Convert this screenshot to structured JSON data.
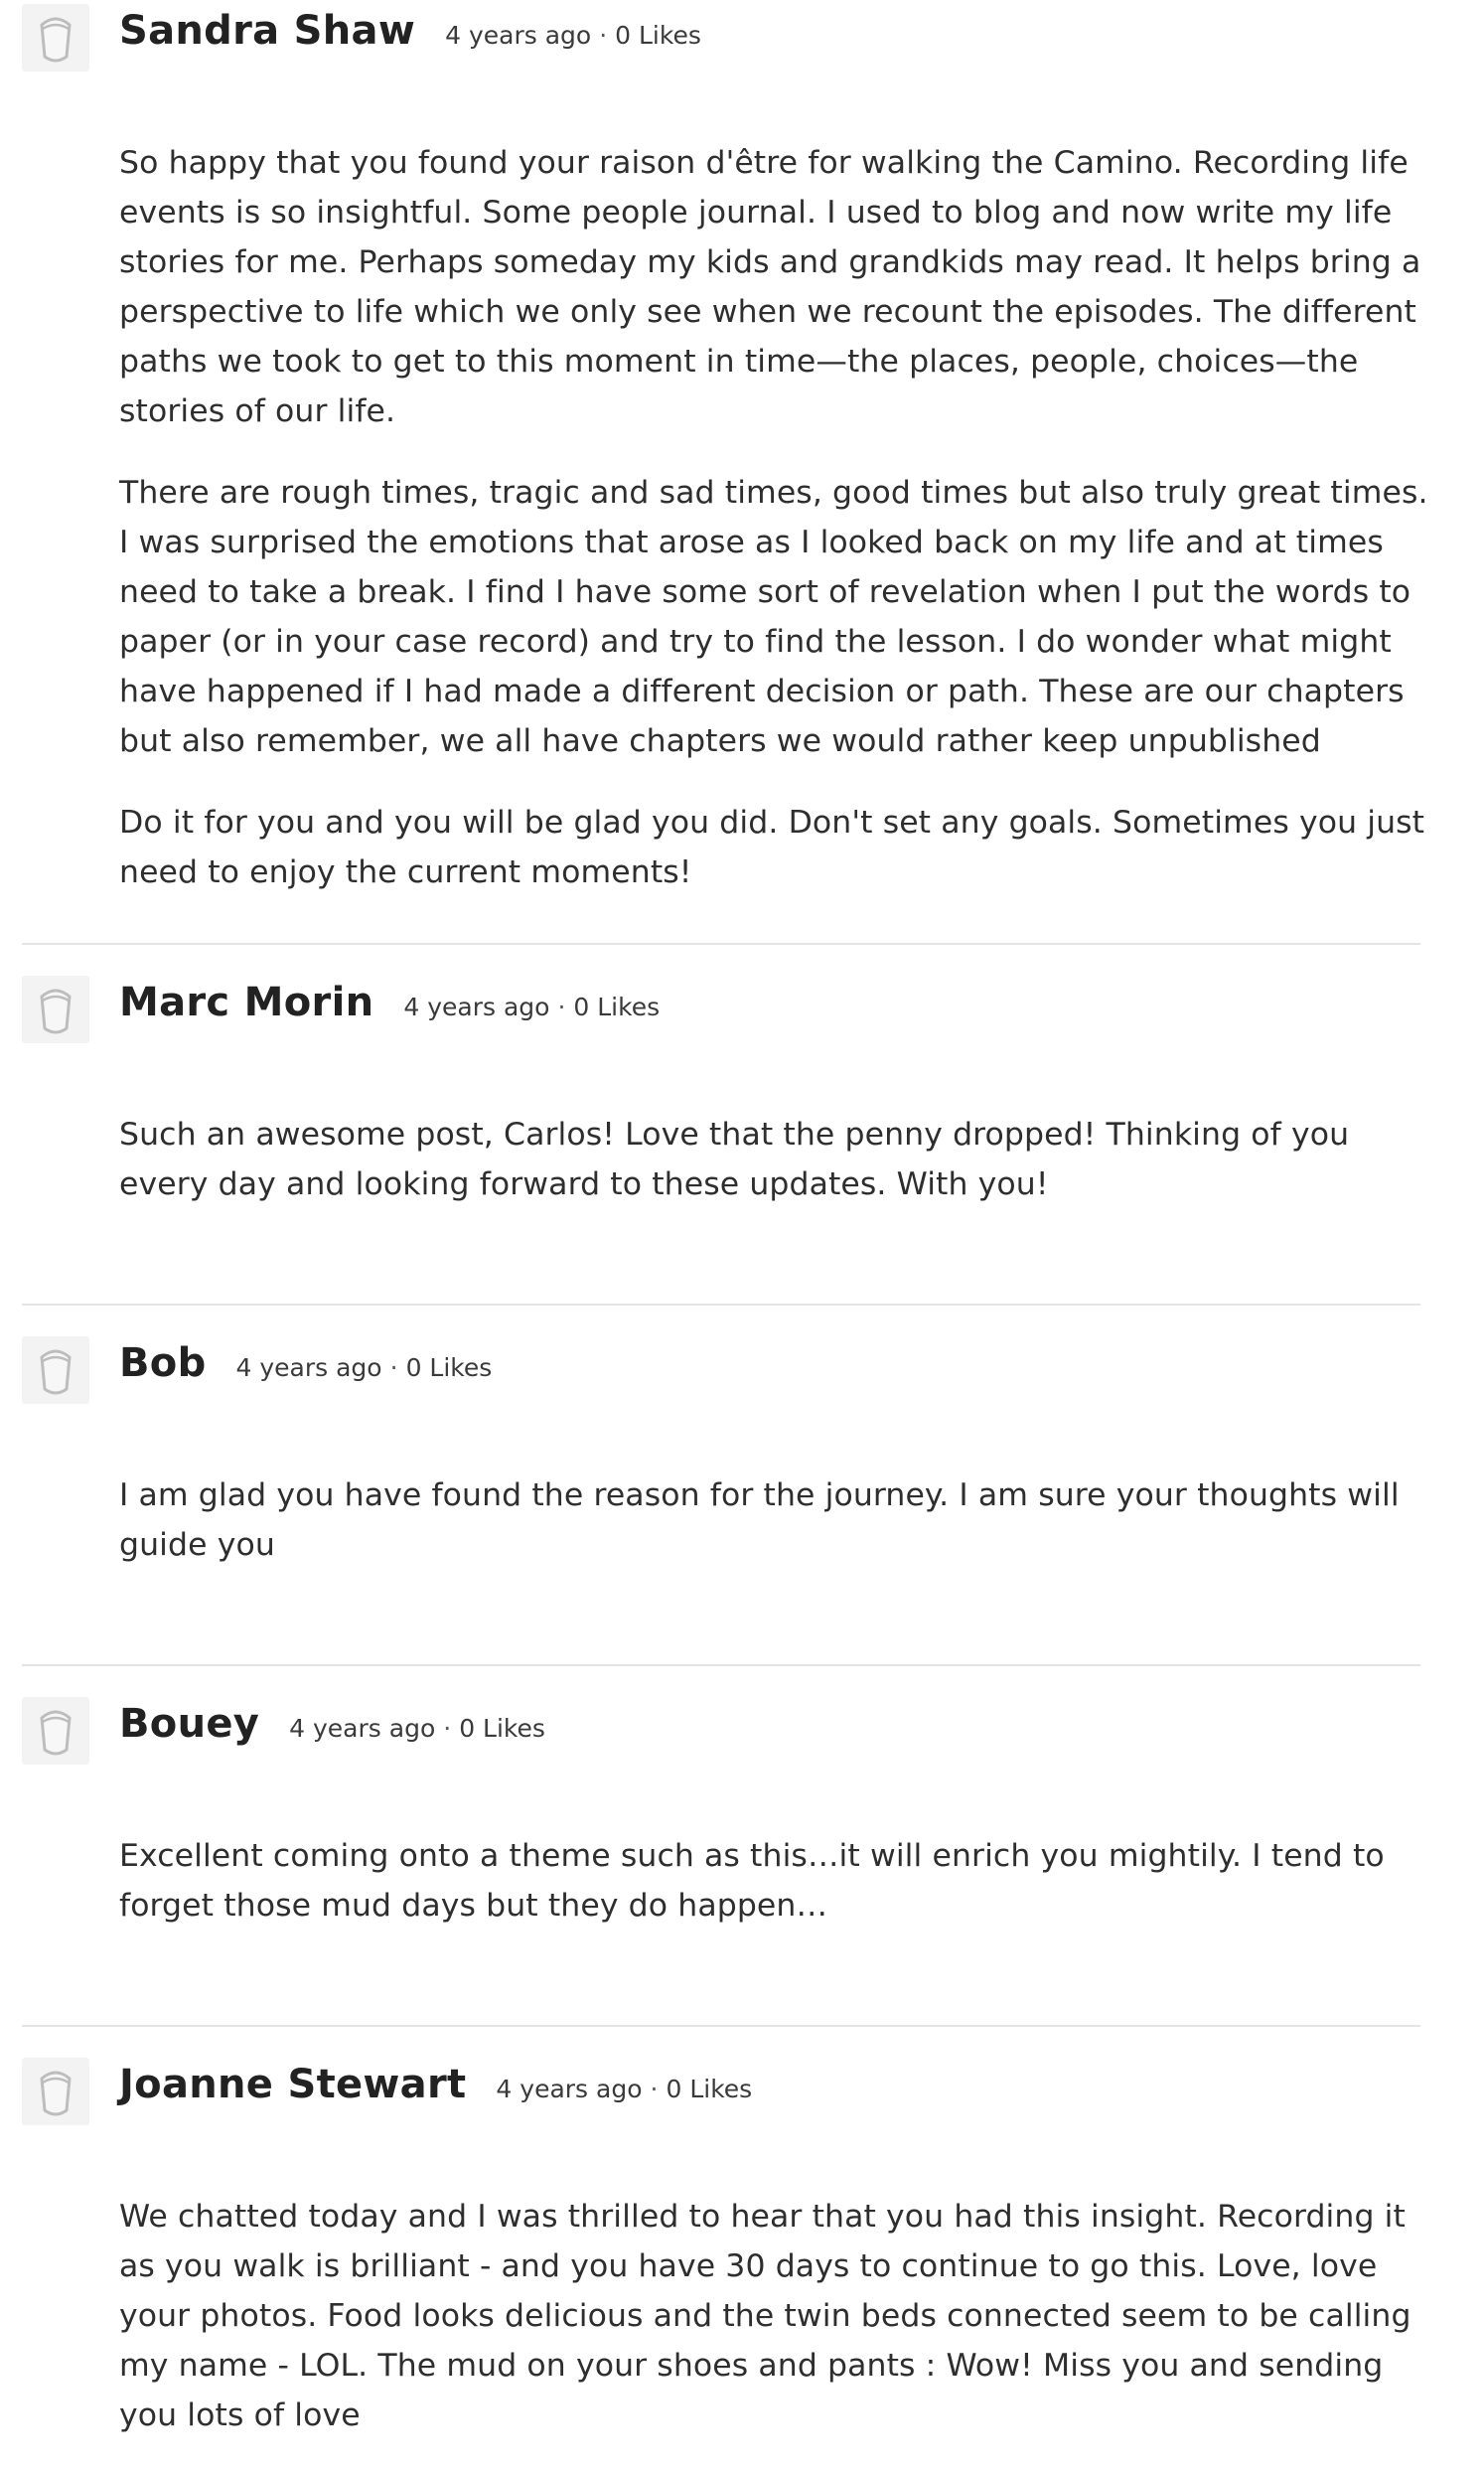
{
  "comments": [
    {
      "author": "Sandra Shaw",
      "time": "4 years ago",
      "likes": "0 Likes",
      "avatar_icon": "user-placeholder-icon",
      "paragraphs": [
        "So happy that you found your raison d'être for walking the Camino. Recording life events is so insightful. Some people journal. I used to blog and now write my life stories for me. Perhaps someday my kids and grandkids may read. It helps bring a perspective to life which we only see when we recount the episodes. The different paths we took to get to this moment in time—the places, people, choices—the stories of our life.",
        "There are rough times, tragic and sad times, good times but also truly great times. I was surprised the emotions that arose as I looked back on my life and at times need to take a break. I find I have some sort of revelation when I put the words to paper (or in your case record) and try to find the lesson. I do wonder what might have happened if I had made a different decision or path. These are our chapters but also remember, we all have chapters we would rather keep unpublished",
        "Do it for you and you will be glad you did. Don't set any goals. Sometimes you just need to enjoy the current moments!"
      ]
    },
    {
      "author": "Marc Morin",
      "time": "4 years ago",
      "likes": "0 Likes",
      "avatar_icon": "user-placeholder-icon",
      "paragraphs": [
        "Such an awesome post, Carlos! Love that the penny dropped! Thinking of you every day and looking forward to these updates. With you!"
      ]
    },
    {
      "author": "Bob",
      "time": "4 years ago",
      "likes": "0 Likes",
      "avatar_icon": "user-placeholder-icon",
      "paragraphs": [
        "I am glad you have found the reason for the journey. I am sure your thoughts will guide you"
      ]
    },
    {
      "author": "Bouey",
      "time": "4 years ago",
      "likes": "0 Likes",
      "avatar_icon": "user-placeholder-icon",
      "paragraphs": [
        "Excellent coming onto a theme such as this…it will enrich you mightily. I tend to forget those mud days but they do happen…"
      ]
    },
    {
      "author": "Joanne Stewart",
      "time": "4 years ago",
      "likes": "0 Likes",
      "avatar_icon": "user-placeholder-icon",
      "paragraphs": [
        "We chatted today and I was thrilled to hear that you had this insight. Recording it as you walk is brilliant - and you have 30 days to continue to go this. Love, love your photos. Food looks delicious and the twin beds connected seem to be calling my name - LOL. The mud on your shoes and pants : Wow! Miss you and sending you lots of love"
      ]
    }
  ],
  "meta_separator": "·",
  "colors": {
    "divider": "#e4e4e4",
    "avatar_bg": "#f3f3f3",
    "avatar_stroke": "#bfbfbf"
  }
}
